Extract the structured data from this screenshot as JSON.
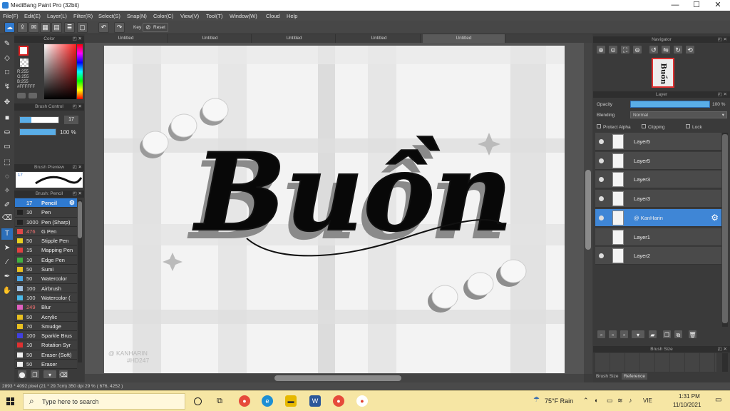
{
  "window": {
    "title": "MediBang Paint Pro (32bit)",
    "minimize": "—",
    "maximize": "☐",
    "close": "✕"
  },
  "menu": [
    "File(F)",
    "Edit(E)",
    "Layer(L)",
    "Filter(R)",
    "Select(S)",
    "Snap(N)",
    "Color(C)",
    "View(V)",
    "Tool(T)",
    "Window(W)",
    "Cloud",
    "Help"
  ],
  "toolbar": {
    "key_label": "Key",
    "reset_label": "Reset"
  },
  "color_panel": {
    "title": "Color",
    "r": "R:255",
    "g": "G:255",
    "b": "B:255",
    "hex": "#FFFFFF"
  },
  "brush_control": {
    "title": "Brush Control",
    "size": "17",
    "opacity": "100 %",
    "opacity_fraction": 1.0
  },
  "brush_preview": {
    "title": "Brush Preview",
    "sample": "17"
  },
  "brush_panel": {
    "title": "Brush: Pencil"
  },
  "brushes": [
    {
      "size": "17",
      "name": "Pencil",
      "color": "#2f7ad0",
      "active": true
    },
    {
      "size": "10",
      "name": "Pen",
      "color": "#222222"
    },
    {
      "size": "1000",
      "name": "Pen (Sharp)",
      "color": "#222222"
    },
    {
      "size": "476",
      "name": "G Pen",
      "color": "#e04848",
      "red": true
    },
    {
      "size": "50",
      "name": "Stipple Pen",
      "color": "#e8d020"
    },
    {
      "size": "15",
      "name": "Mapping Pen",
      "color": "#e04040"
    },
    {
      "size": "10",
      "name": "Edge Pen",
      "color": "#40b040"
    },
    {
      "size": "50",
      "name": "Sumi",
      "color": "#e8c020"
    },
    {
      "size": "50",
      "name": "Watercolor",
      "color": "#4aa8e8"
    },
    {
      "size": "100",
      "name": "Airbrush",
      "color": "#a0c0e0"
    },
    {
      "size": "100",
      "name": "Watercolor (",
      "color": "#4ab8e8"
    },
    {
      "size": "249",
      "name": "Blur",
      "color": "#e060c0",
      "red": true
    },
    {
      "size": "50",
      "name": "Acrylic",
      "color": "#e8c020"
    },
    {
      "size": "70",
      "name": "Smudge",
      "color": "#e8c020"
    },
    {
      "size": "100",
      "name": "Sparkle Brus",
      "color": "#4040e0"
    },
    {
      "size": "10",
      "name": "Rotation Syr",
      "color": "#e03030"
    },
    {
      "size": "50",
      "name": "Eraser (Soft)",
      "color": "#f0f0f0"
    },
    {
      "size": "50",
      "name": "Eraser",
      "color": "#f0f0f0"
    }
  ],
  "tabs": [
    "Untitled",
    "Untitled",
    "Untitled",
    "Untitled",
    "Untitled"
  ],
  "artwork": {
    "text": "Buồn",
    "signature_line1": "@ KANHARIN",
    "signature_line2": "#HD247"
  },
  "navigator": {
    "title": "Navigator",
    "thumb_text": "Buồn"
  },
  "layer_panel": {
    "title": "Layer",
    "opacity_label": "Opacity",
    "opacity_value": "100 %",
    "blending_label": "Blending",
    "blending_value": "Normal",
    "protect_alpha": "Protect Alpha",
    "clipping": "Clipping",
    "lock": "Lock"
  },
  "layers": [
    {
      "name": "Layer5",
      "visible": true,
      "active": false
    },
    {
      "name": "Layer5",
      "visible": true,
      "active": false
    },
    {
      "name": "Layer3",
      "visible": true,
      "active": false
    },
    {
      "name": "Layer3",
      "visible": true,
      "active": false
    },
    {
      "name": "@ KanHarin",
      "visible": true,
      "active": true
    },
    {
      "name": "Layer1",
      "visible": false,
      "active": false
    },
    {
      "name": "Layer2",
      "visible": true,
      "active": false
    }
  ],
  "brush_size_panel": {
    "title": "Brush Size",
    "tab1": "Brush Size",
    "tab2": "Reference"
  },
  "status": "2893 * 4092 pixel  (21 * 29.7cm)  350 dpi  29 %  ( 676, 4252 )",
  "taskbar": {
    "search_placeholder": "Type here to search",
    "weather": "75°F  Rain",
    "lang": "VIE",
    "time": "1:31 PM",
    "date": "11/10/2021"
  }
}
